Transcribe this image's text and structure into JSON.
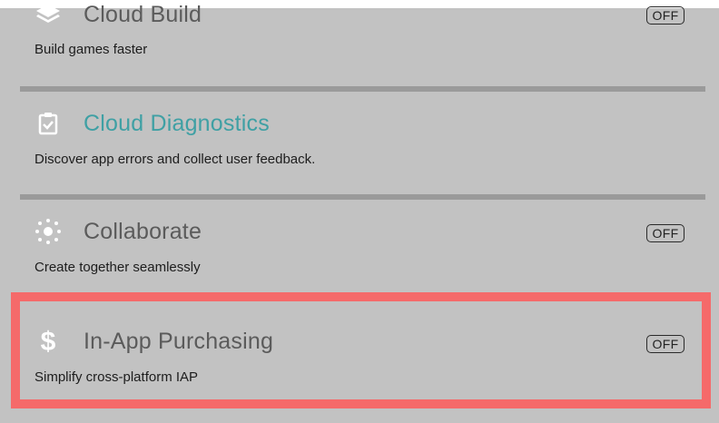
{
  "services": [
    {
      "title": "Cloud Build",
      "description": "Build games faster",
      "toggle": "OFF",
      "icon": "layers-icon"
    },
    {
      "title": "Cloud Diagnostics",
      "description": "Discover app errors and collect user feedback.",
      "icon": "clipboard-check-icon"
    },
    {
      "title": "Collaborate",
      "description": "Create together seamlessly",
      "toggle": "OFF",
      "icon": "collaborate-dots-icon"
    },
    {
      "title": "In-App Purchasing",
      "description": "Simplify cross-platform IAP",
      "toggle": "OFF",
      "icon": "dollar-icon"
    }
  ],
  "colors": {
    "panel_background": "#c2c2c2",
    "divider": "#9a9a9a",
    "link_title": "#3fa0a4",
    "highlight_border": "#f56a6a"
  }
}
